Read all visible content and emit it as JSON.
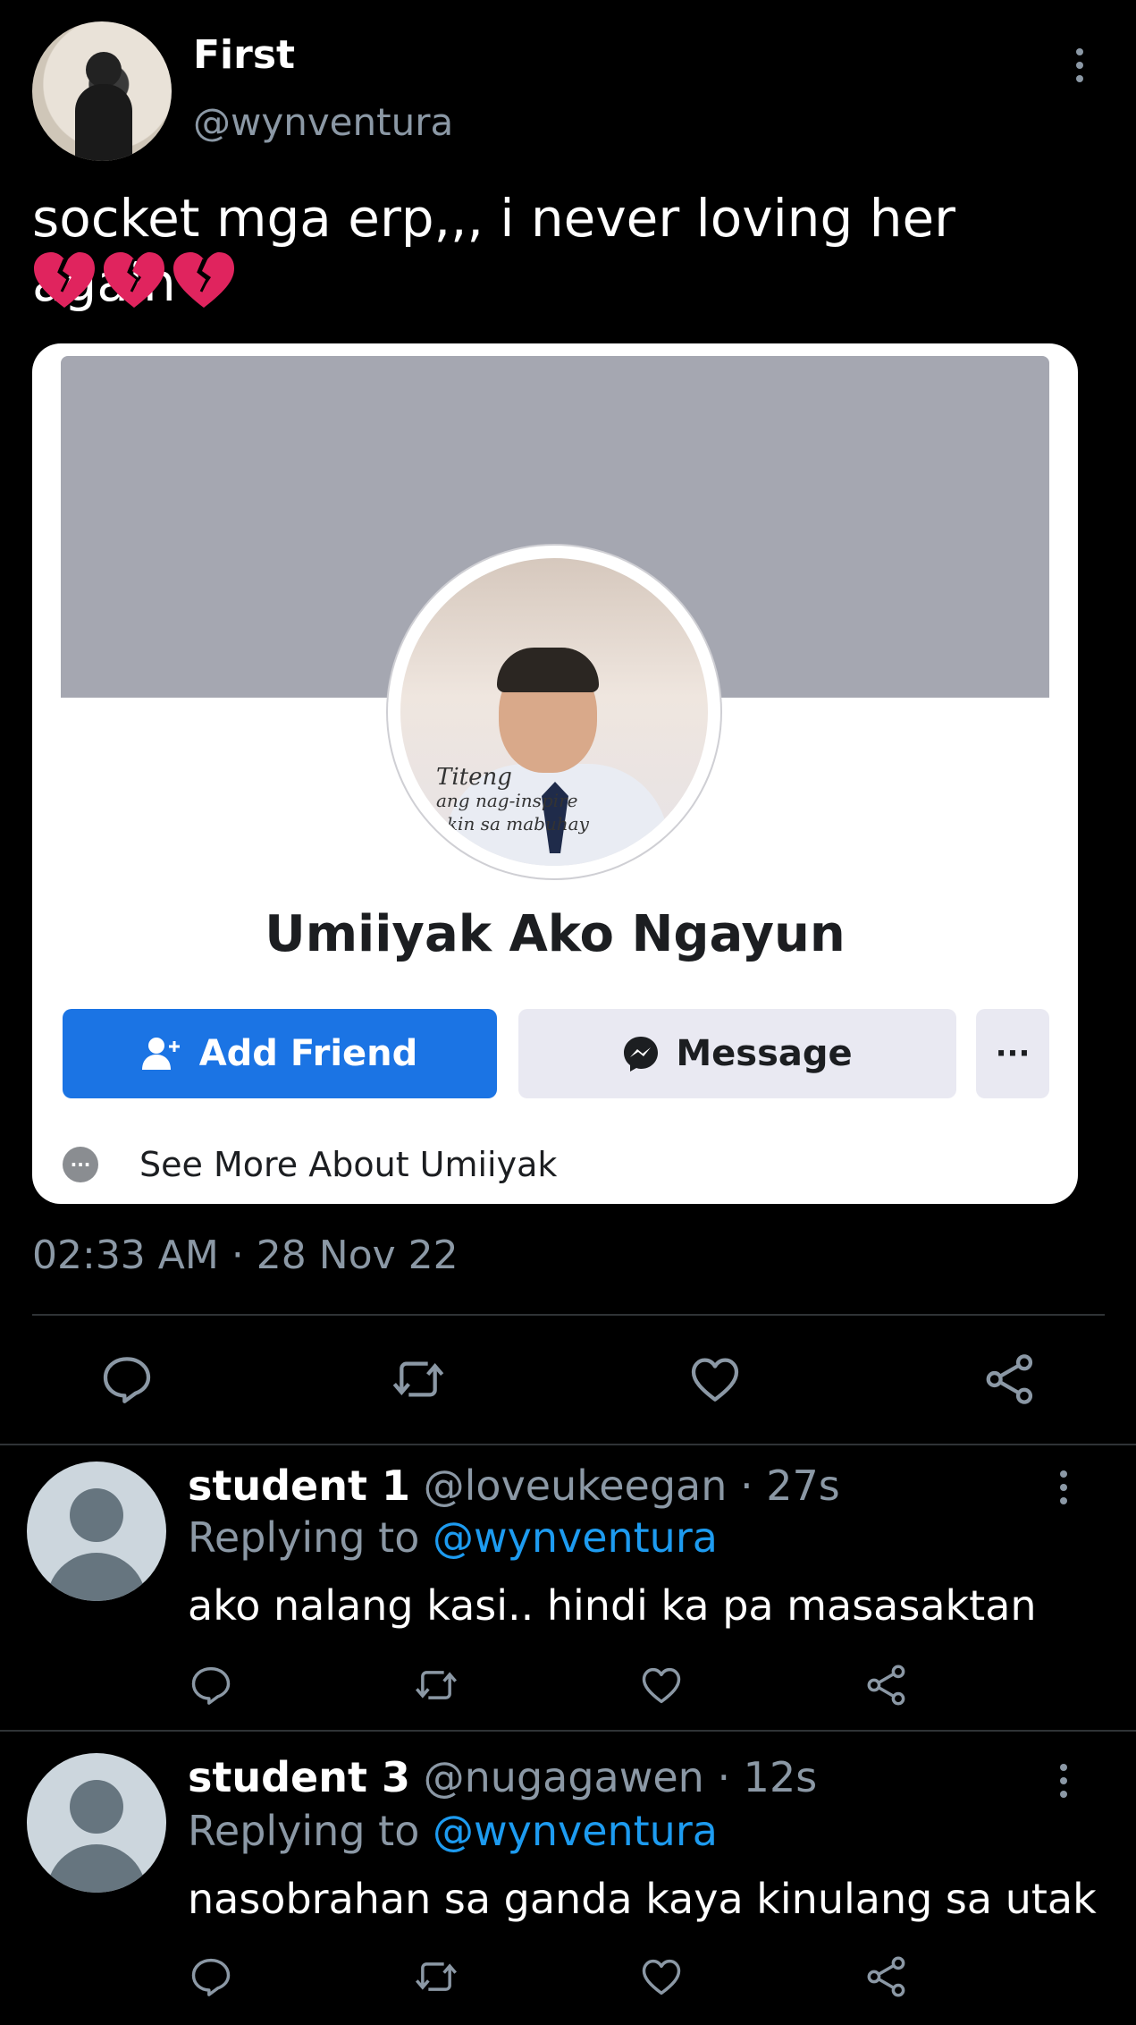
{
  "tweet": {
    "display_name": "First",
    "handle": "@wynventura",
    "text": "socket mga erp,,, i never loving her again",
    "emoji_count": 3,
    "timestamp": "02:33 AM · 28 Nov 22"
  },
  "embedded_card": {
    "name": "Umiiyak Ako Ngayun",
    "photo_caption_lines": [
      "Titeng",
      "ang nag-inspire",
      "akin sa mabuhay"
    ],
    "add_friend_label": "Add Friend",
    "message_label": "Message",
    "more_label": "···",
    "see_more_label": "See More About Umiiyak"
  },
  "replies": [
    {
      "name": "student 1",
      "handle": "@loveukeegan",
      "time": "· 27s",
      "replying_prefix": "Replying to",
      "replying_to": "@wynventura",
      "text": "ako nalang kasi.. hindi ka pa masasaktan"
    },
    {
      "name": "student 3",
      "handle": "@nugagawen",
      "time": "· 12s",
      "replying_prefix": "Replying to",
      "replying_to": "@wynventura",
      "text": "nasobrahan sa ganda kaya kinulang sa utak"
    }
  ],
  "colors": {
    "background": "#000000",
    "secondary_text": "#8b98a5",
    "link": "#1d9bf0",
    "facebook_blue": "#1b74e4",
    "broken_heart": "#e0245e"
  },
  "icons": {
    "reply": "reply-bubble-icon",
    "retweet": "retweet-icon",
    "like": "heart-outline-icon",
    "share": "share-icon",
    "more": "kebab-icon",
    "emoji": "broken-heart-icon"
  }
}
